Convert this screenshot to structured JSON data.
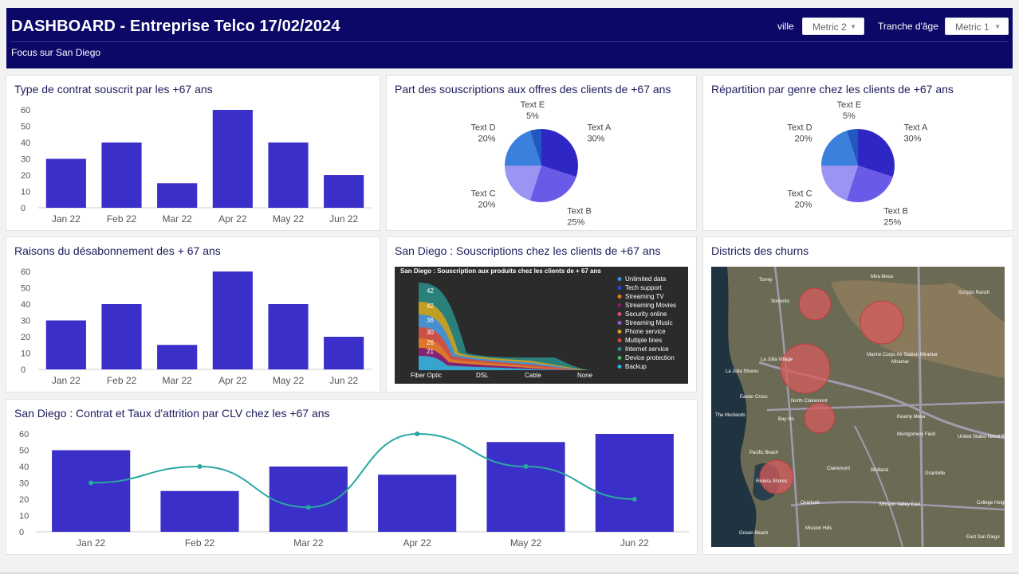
{
  "header": {
    "title": "DASHBOARD - Entreprise Telco 17/02/2024",
    "subtitle": "Focus sur San Diego",
    "filter1_label": "ville",
    "filter1_value": "Metric 2",
    "filter2_label": "Tranche d'âge",
    "filter2_value": "Metric 1"
  },
  "colors": {
    "header_bg": "#0c0868",
    "bar": "#3a2fc8",
    "line": "#2aa8a0"
  },
  "cards": {
    "contract": {
      "title": "Type de contrat souscrit par les +67 ans"
    },
    "offers": {
      "title": "Part des souscriptions aux offres des clients de +67 ans"
    },
    "gender": {
      "title": "Répartition par genre chez les clients de +67 ans"
    },
    "churn_reasons": {
      "title": "Raisons du désabonnement des + 67 ans"
    },
    "sd_subscriptions": {
      "title": "San Diego : Souscriptions chez les clients de +67 ans",
      "image_title": "San Diego : Souscription aux produits chez les clients de + 67 ans",
      "categories": [
        "Fiber Optic",
        "DSL",
        "Cable",
        "None"
      ],
      "value_labels": [
        "42",
        "42",
        "36",
        "30",
        "26",
        "21"
      ],
      "legend": [
        "Unlimited data",
        "Tech support",
        "Streaming TV",
        "Streaming Movies",
        "Security online",
        "Streaming Music",
        "Phone service",
        "Multiple lines",
        "Internet service",
        "Device protection",
        "Backup"
      ]
    },
    "clv": {
      "title": "San Diego : Contrat et Taux d'attrition par CLV chez les +67 ans"
    },
    "districts": {
      "title": "Districts des churns",
      "map_labels": [
        "Sorrento",
        "Mira Mesa",
        "Scripps Ranch",
        "Marine Corps Air Station Miramar",
        "La Jolla Shores",
        "La Jolla Village",
        "Easter Cross",
        "The Muirlands",
        "North Clairemont",
        "Kearny Mesa",
        "Bay Ho",
        "Clairemont",
        "Montgomery Field",
        "Pacific Beach",
        "Riviera Shores",
        "Overlook",
        "Mission Valley East",
        "College Heights",
        "East San Diego",
        "Grantville",
        "Birdland",
        "Ocean Beach",
        "Mission Hills",
        "United States Naval Recreational Facility",
        "Miramar",
        "Torrey"
      ]
    }
  },
  "chart_data": [
    {
      "type": "bar",
      "title": "Type de contrat souscrit par les +67 ans",
      "categories": [
        "Jan 22",
        "Feb 22",
        "Mar 22",
        "Apr 22",
        "May 22",
        "Jun 22"
      ],
      "values": [
        30,
        40,
        15,
        60,
        40,
        20
      ],
      "yticks": [
        0,
        10,
        20,
        30,
        40,
        50,
        60
      ],
      "ylim": [
        0,
        60
      ]
    },
    {
      "type": "pie",
      "title": "Part des souscriptions aux offres des clients de +67 ans",
      "labels": [
        "Text A",
        "Text B",
        "Text C",
        "Text D",
        "Text E"
      ],
      "values": [
        30,
        25,
        20,
        20,
        5
      ],
      "display": [
        "30%",
        "25%",
        "20%",
        "20%",
        "5%"
      ],
      "colors": [
        "#2e27c4",
        "#6a5ae8",
        "#9a94f2",
        "#3a80dc",
        "#2256c0"
      ]
    },
    {
      "type": "pie",
      "title": "Répartition par genre chez les clients de +67 ans",
      "labels": [
        "Text A",
        "Text B",
        "Text C",
        "Text D",
        "Text E"
      ],
      "values": [
        30,
        25,
        20,
        20,
        5
      ],
      "display": [
        "30%",
        "25%",
        "20%",
        "20%",
        "5%"
      ],
      "colors": [
        "#2e27c4",
        "#6a5ae8",
        "#9a94f2",
        "#3a80dc",
        "#2256c0"
      ]
    },
    {
      "type": "bar",
      "title": "Raisons du désabonnement des + 67 ans",
      "categories": [
        "Jan 22",
        "Feb 22",
        "Mar 22",
        "Apr 22",
        "May 22",
        "Jun 22"
      ],
      "values": [
        30,
        40,
        15,
        60,
        40,
        20
      ],
      "yticks": [
        0,
        10,
        20,
        30,
        40,
        50,
        60
      ],
      "ylim": [
        0,
        60
      ]
    },
    {
      "type": "bar",
      "title": "San Diego : Contrat et Taux d'attrition par CLV chez les +67 ans",
      "categories": [
        "Jan 22",
        "Feb 22",
        "Mar 22",
        "Apr 22",
        "May 22",
        "Jun 22"
      ],
      "series": [
        {
          "type": "bar",
          "values": [
            50,
            25,
            40,
            35,
            55,
            60
          ]
        },
        {
          "type": "line",
          "values": [
            30,
            40,
            15,
            60,
            40,
            20
          ]
        }
      ],
      "yticks": [
        0,
        10,
        20,
        30,
        40,
        50,
        60
      ],
      "ylim": [
        0,
        60
      ]
    }
  ]
}
